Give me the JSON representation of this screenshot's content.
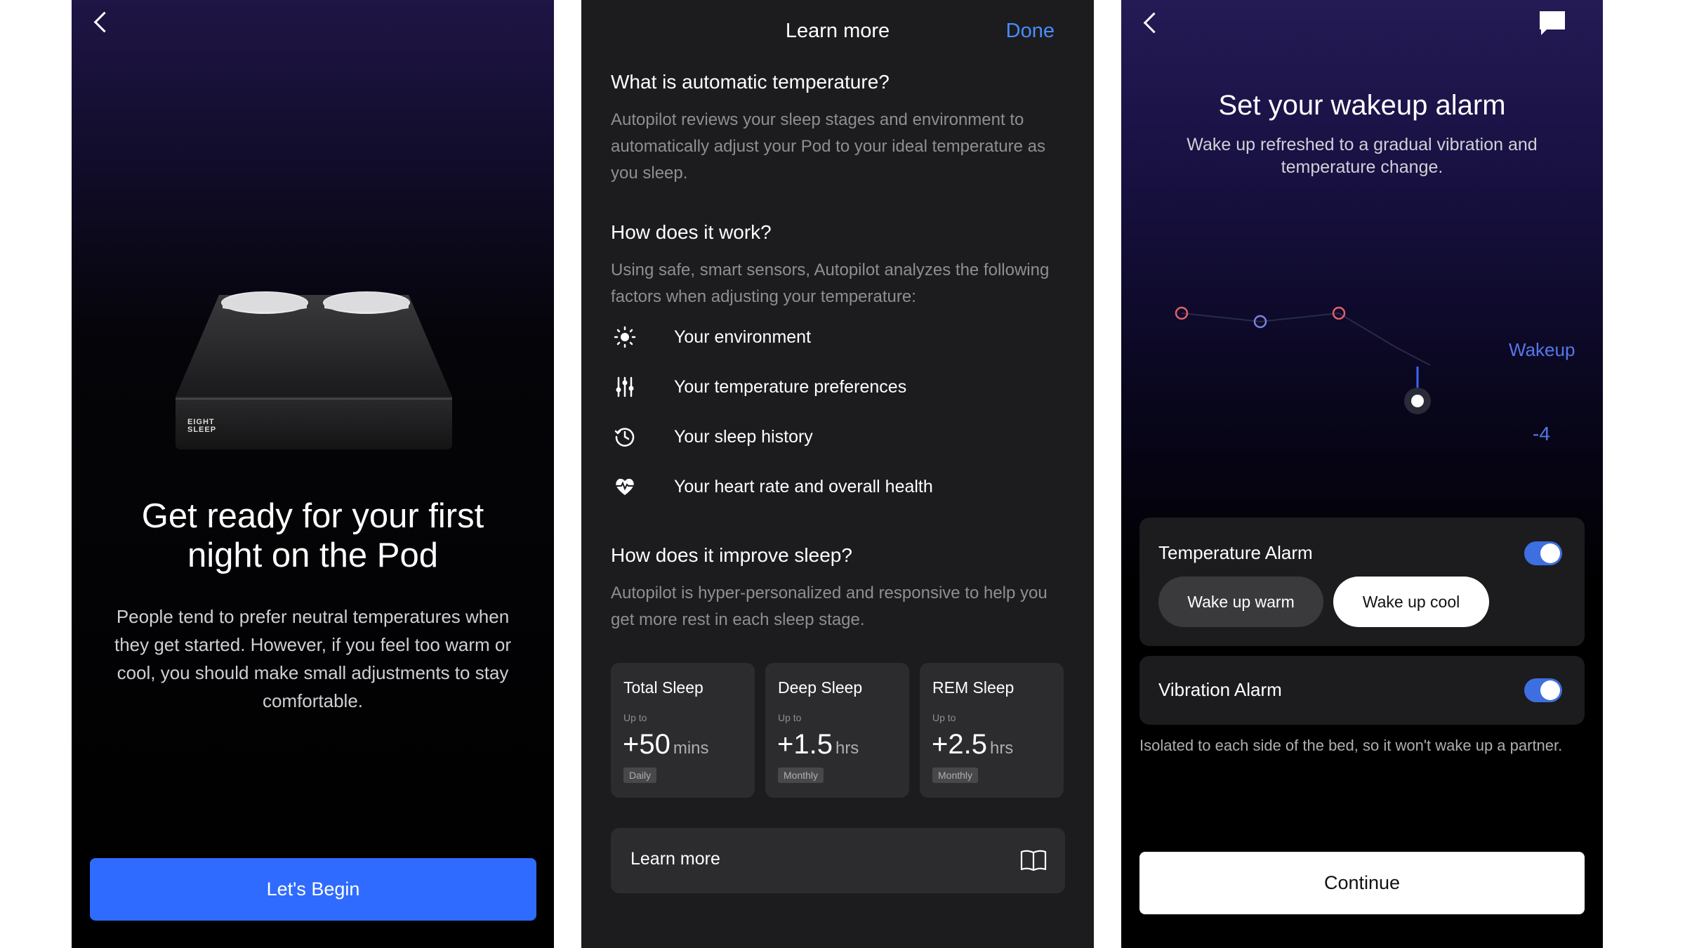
{
  "screen1": {
    "title": "Get ready for your first night on the Pod",
    "body": "People tend to prefer neutral temperatures when they get started. However, if you feel too warm or cool, you should make small adjustments to stay comfortable.",
    "cta_label": "Let's Begin",
    "bed_brand": "EIGHT SLEEP",
    "accent_color": "#2f6bff"
  },
  "screen2": {
    "header_title": "Learn more",
    "done_label": "Done",
    "q1": "What is automatic temperature?",
    "a1": "Autopilot reviews your sleep stages and environment to automatically adjust your Pod to your ideal temperature as you sleep.",
    "q2": "How does it work?",
    "a2": "Using safe, smart sensors, Autopilot analyzes the following factors when adjusting your temperature:",
    "factors": [
      {
        "icon": "sun-icon",
        "label": "Your environment"
      },
      {
        "icon": "sliders-icon",
        "label": "Your temperature preferences"
      },
      {
        "icon": "history-icon",
        "label": "Your sleep history"
      },
      {
        "icon": "heart-rate-icon",
        "label": "Your heart rate and overall health"
      }
    ],
    "q3": "How does it improve sleep?",
    "a3": "Autopilot is hyper-personalized and responsive to help you get more rest in each sleep stage.",
    "stats": [
      {
        "title": "Total Sleep",
        "prefix": "Up to",
        "value": "+50",
        "unit": "mins",
        "period": "Daily"
      },
      {
        "title": "Deep Sleep",
        "prefix": "Up to",
        "value": "+1.5",
        "unit": "hrs",
        "period": "Monthly"
      },
      {
        "title": "REM Sleep",
        "prefix": "Up to",
        "value": "+2.5",
        "unit": "hrs",
        "period": "Monthly"
      }
    ],
    "learn_more_label": "Learn more",
    "accent_color": "#4a8cff"
  },
  "screen3": {
    "title": "Set your wakeup alarm",
    "body": "Wake up refreshed to a gradual vibration and temperature change.",
    "wakeup_label": "Wakeup",
    "wakeup_value": "-4",
    "temperature_alarm_label": "Temperature Alarm",
    "temperature_alarm_on": true,
    "wake_warm_label": "Wake up warm",
    "wake_cool_label": "Wake up cool",
    "selected_mode": "Wake up cool",
    "vibration_alarm_label": "Vibration Alarm",
    "vibration_alarm_on": true,
    "note": "Isolated to each side of the bed, so it won't wake up a partner.",
    "continue_label": "Continue",
    "toggle_color": "#3e6fe0",
    "warm_point_color": "#e0606a",
    "cool_point_color": "#7a82e0"
  }
}
